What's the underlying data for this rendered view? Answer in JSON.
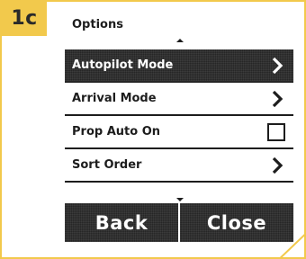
{
  "step": {
    "label": "1c"
  },
  "screen": {
    "title": "Options",
    "menu": [
      {
        "label": "Autopilot Mode",
        "control": "chevron-right-icon",
        "selected": true
      },
      {
        "label": "Arrival Mode",
        "control": "chevron-right-icon",
        "selected": false
      },
      {
        "label": "Prop Auto On",
        "control": "checkbox",
        "checked": false,
        "selected": false
      },
      {
        "label": "Sort Order",
        "control": "chevron-right-icon",
        "selected": false
      }
    ],
    "buttons": {
      "back": "Back",
      "close": "Close"
    }
  },
  "colors": {
    "accent": "#f2c94c",
    "screen_dark": "#262626",
    "text": "#1d1d1d",
    "background": "#ffffff"
  }
}
